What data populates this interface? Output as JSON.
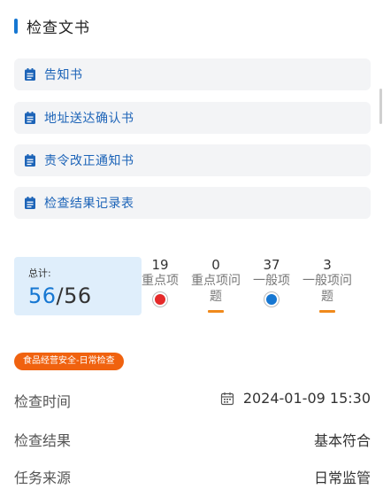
{
  "section": {
    "title": "检查文书"
  },
  "documents": [
    {
      "label": "告知书"
    },
    {
      "label": "地址送达确认书"
    },
    {
      "label": "责令改正通知书"
    },
    {
      "label": "检查结果记录表"
    }
  ],
  "summary": {
    "total_label": "总计:",
    "total_done": "56",
    "total_sep": "/",
    "total_all": "56"
  },
  "stats": [
    {
      "count": "19",
      "label": "重点项",
      "marker": "red-dot",
      "marker_color": "#e52a2a"
    },
    {
      "count": "0",
      "label": "重点项问题",
      "marker": "orange-dash",
      "marker_color": "#f08a1c"
    },
    {
      "count": "37",
      "label": "一般项",
      "marker": "blue-dot",
      "marker_color": "#1677d2"
    },
    {
      "count": "3",
      "label": "一般项问题",
      "marker": "orange-dash",
      "marker_color": "#f08a1c"
    }
  ],
  "tag": {
    "label": "食品经营安全-日常检查"
  },
  "details": [
    {
      "key": "检查时间",
      "value": "2024-01-09 15:30",
      "icon": "calendar-icon"
    },
    {
      "key": "检查结果",
      "value": "基本符合"
    },
    {
      "key": "任务来源",
      "value": "日常监管"
    }
  ],
  "colors": {
    "accent": "#1677d2",
    "tag": "#f0620f",
    "card_bg": "#dfeefb"
  }
}
